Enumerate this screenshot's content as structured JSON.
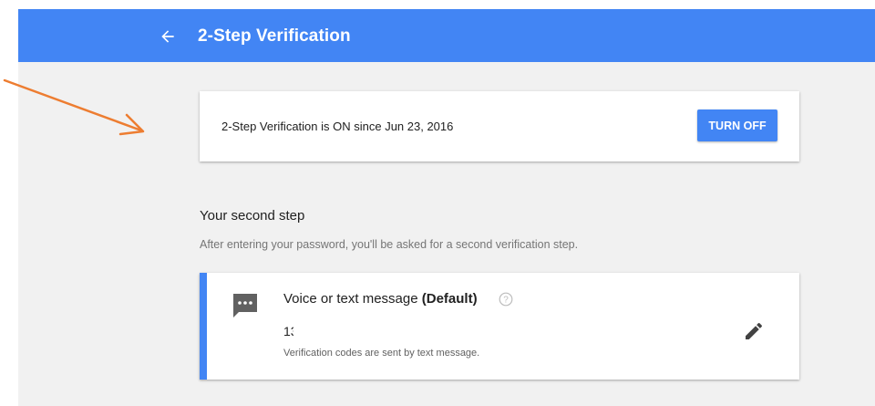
{
  "appbar": {
    "title": "2-Step Verification",
    "back_icon": "arrow-left-icon",
    "color": "#4285f4"
  },
  "status_card": {
    "text": "2-Step Verification is ON since Jun 23, 2016",
    "turn_off_label": "TURN OFF"
  },
  "second_step": {
    "title": "Your second step",
    "description": "After entering your password, you'll be asked for a second verification step."
  },
  "method": {
    "icon": "sms-message-icon",
    "title": "Voice or text message",
    "default_label": "(Default)",
    "help_icon": "help-circle-icon",
    "phone": "13         88",
    "note": "Verification codes are sent by text message.",
    "edit_icon": "pencil-edit-icon",
    "accent_color": "#4285f4"
  },
  "annotation": {
    "arrow_color": "#ed7d31"
  }
}
